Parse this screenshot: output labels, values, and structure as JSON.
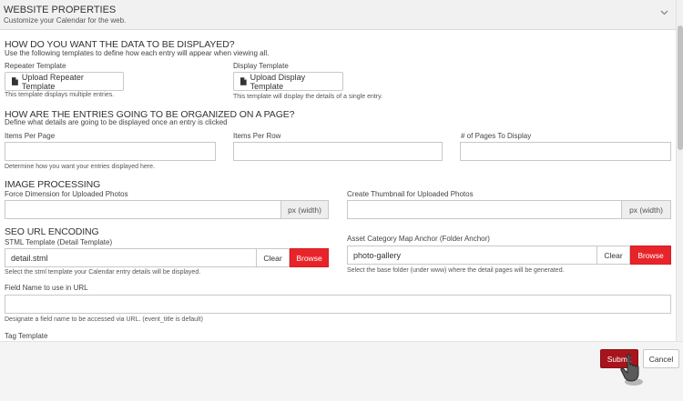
{
  "header": {
    "title": "WEBSITE PROPERTIES",
    "subtitle": "Customize your Calendar for the web.",
    "collapse_icon": "chevron-down-icon"
  },
  "display_section": {
    "title": "HOW DO YOU WANT THE DATA TO BE DISPLAYED?",
    "subtitle": "Use the following templates to define how each entry will appear when viewing all.",
    "repeater": {
      "label": "Repeater Template",
      "button": "Upload Repeater Template",
      "help": "This template displays multiple entries."
    },
    "display": {
      "label": "Display Template",
      "button": "Upload Display Template",
      "help": "This template will display the details of a single entry."
    }
  },
  "organize_section": {
    "title": "HOW ARE THE ENTRIES GOING TO BE ORGANIZED ON A PAGE?",
    "subtitle": "Define what details are going to be displayed once an entry is clicked",
    "items_per_page": {
      "label": "Items Per Page",
      "value": ""
    },
    "items_per_row": {
      "label": "Items Per Row",
      "value": ""
    },
    "pages_to_display": {
      "label": "# of Pages To Display",
      "value": ""
    },
    "help": "Determine how you want your entries displayed here."
  },
  "image_section": {
    "title": "IMAGE PROCESSING",
    "force_dimension": {
      "label": "Force Dimension for Uploaded Photos",
      "value": "",
      "addon": "px (width)"
    },
    "thumbnail": {
      "label": "Create Thumbnail for Uploaded Photos",
      "value": "",
      "addon": "px (width)"
    }
  },
  "seo_section": {
    "title": "SEO URL ENCODING",
    "stml_template": {
      "label": "STML Template (Detail Template)",
      "value": "detail.stml",
      "clear": "Clear",
      "browse": "Browse",
      "help": "Select the stml template your Calendar entry details will be displayed."
    },
    "asset_anchor": {
      "label": "Asset Category Map Anchor (Folder Anchor)",
      "value": "photo-gallery",
      "clear": "Clear",
      "browse": "Browse",
      "help": "Select the base folder (under www) where the detail pages will be generated."
    },
    "field_name": {
      "label": "Field Name to use in URL",
      "value": "",
      "help": "Designate a field name to be accessed via URL. (event_title is default)"
    },
    "tag_template": {
      "label": "Tag Template"
    }
  },
  "footer": {
    "submit": "Submit",
    "cancel": "Cancel"
  },
  "colors": {
    "browse": "#e8242b",
    "submit": "#a8141c"
  }
}
